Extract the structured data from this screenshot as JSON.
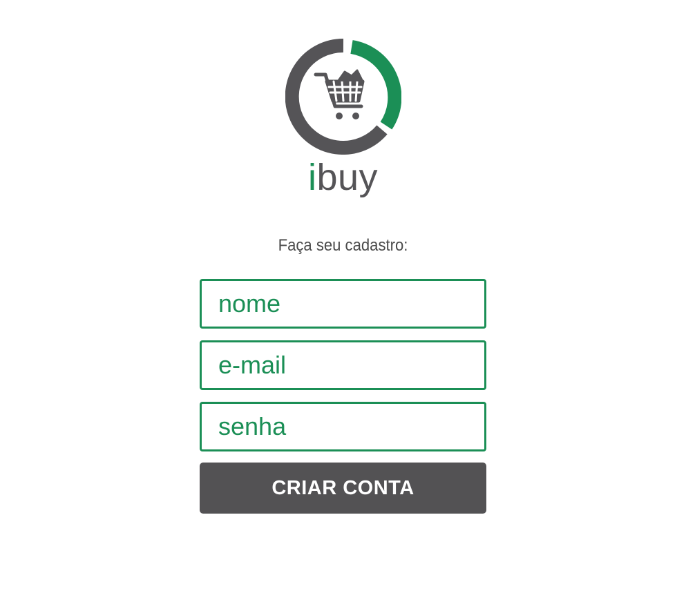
{
  "brand": {
    "first_letter": "i",
    "rest": "buy",
    "logo_icon": "shopping-cart-icon",
    "colors": {
      "accent": "#1b8f56",
      "dark": "#555457",
      "button": "#535254"
    }
  },
  "form": {
    "subtitle": "Faça seu cadastro:",
    "fields": [
      {
        "placeholder": "nome",
        "value": ""
      },
      {
        "placeholder": "e-mail",
        "value": ""
      },
      {
        "placeholder": "senha",
        "value": ""
      }
    ],
    "submit_label": "CRIAR CONTA"
  }
}
